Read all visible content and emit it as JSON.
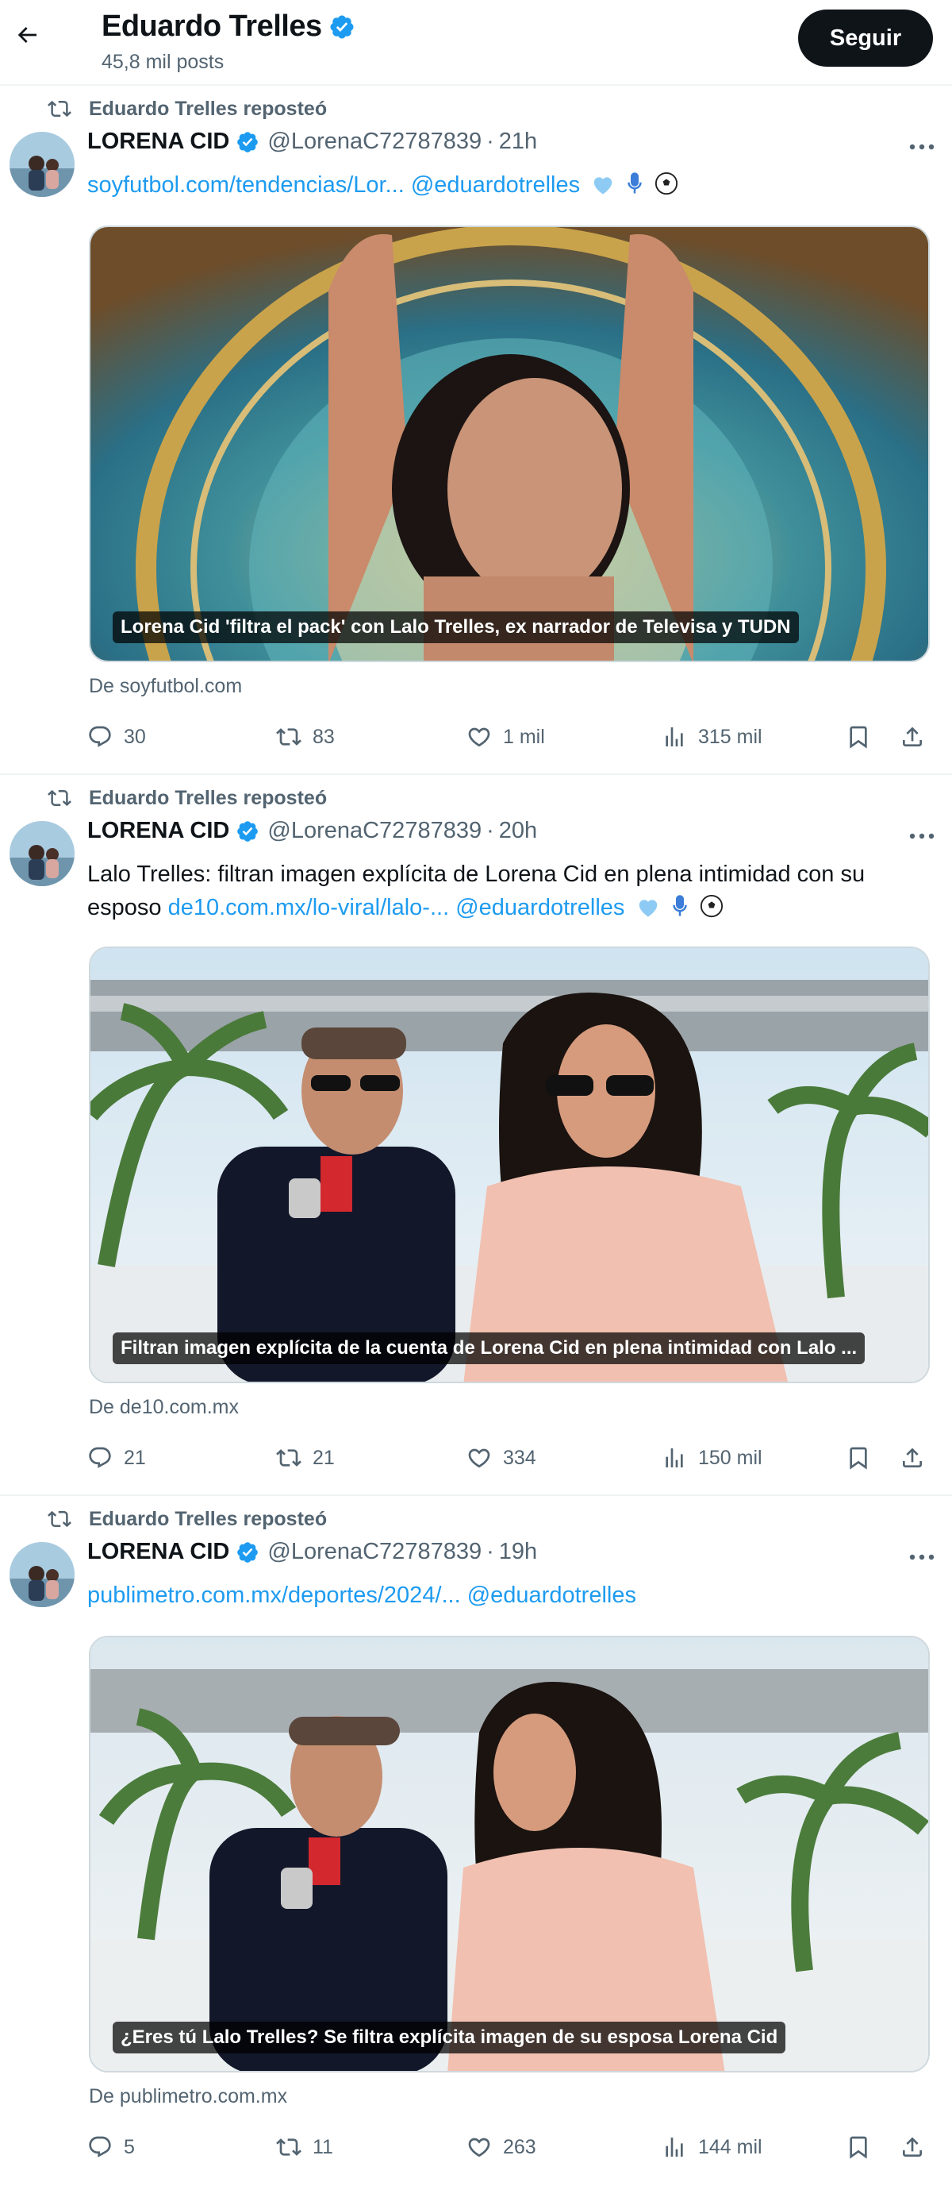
{
  "header": {
    "name": "Eduardo Trelles",
    "post_count": "45,8 mil posts",
    "follow_label": "Seguir"
  },
  "tweets": [
    {
      "repost_label": "Eduardo Trelles reposteó",
      "author_name": "LORENA CID",
      "handle": "@LorenaC72787839",
      "separator": "·",
      "time": "21h",
      "text_plain": "",
      "link1": "soyfutbol.com/tendencias/Lor...",
      "mention": "@eduardotrelles",
      "caption": "Lorena Cid 'filtra el pack' con Lalo Trelles, ex narrador de Televisa y TUDN",
      "source": "De soyfutbol.com",
      "replies": "30",
      "reposts": "83",
      "likes": "1 mil",
      "views": "315 mil"
    },
    {
      "repost_label": "Eduardo Trelles reposteó",
      "author_name": "LORENA CID",
      "handle": "@LorenaC72787839",
      "separator": "·",
      "time": "20h",
      "text_plain": "Lalo Trelles: filtran imagen explícita de Lorena Cid en plena intimidad con su esposo",
      "link1": "de10.com.mx/lo-viral/lalo-...",
      "mention": "@eduardotrelles",
      "caption": "Filtran imagen explícita de la cuenta de Lorena Cid en plena intimidad con Lalo ...",
      "source": "De de10.com.mx",
      "replies": "21",
      "reposts": "21",
      "likes": "334",
      "views": "150 mil"
    },
    {
      "repost_label": "Eduardo Trelles reposteó",
      "author_name": "LORENA CID",
      "handle": "@LorenaC72787839",
      "separator": "·",
      "time": "19h",
      "text_plain": "",
      "link1": "publimetro.com.mx/deportes/2024/...",
      "mention": "@eduardotrelles",
      "caption": "¿Eres tú Lalo Trelles? Se filtra explícita imagen de su esposa Lorena Cid",
      "source": "De publimetro.com.mx",
      "replies": "5",
      "reposts": "11",
      "likes": "263",
      "views": "144 mil"
    }
  ],
  "colors": {
    "accent": "#1d9bf0",
    "text": "#0f1419",
    "muted": "#536471",
    "border": "#eff3f4",
    "button_bg": "#0f1419"
  },
  "icons": [
    "back-arrow-icon",
    "verified-badge-icon",
    "repost-icon",
    "more-icon",
    "reply-icon",
    "like-icon",
    "views-icon",
    "bookmark-icon",
    "share-icon",
    "blue-heart-emoji",
    "microphone-emoji",
    "soccer-ball-emoji"
  ]
}
